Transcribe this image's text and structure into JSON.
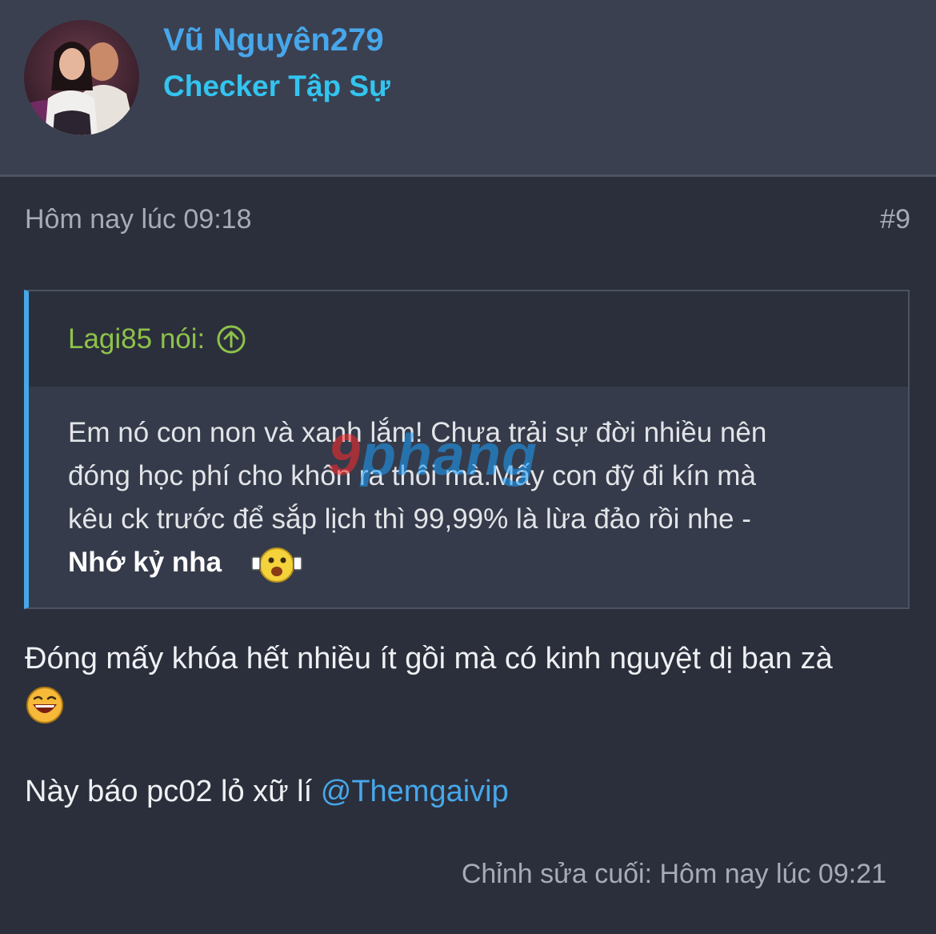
{
  "user": {
    "name": "Vũ Nguyên279",
    "title": "Checker Tập Sự",
    "avatar_icon": "profile-photo-avatar"
  },
  "post": {
    "time": "Hôm nay lúc 09:18",
    "number": "#9",
    "quote": {
      "author": "Lagi85 nói:",
      "jump_icon": "arrow-up-circle-icon",
      "lines": [
        "Em nó con non và xanh lắm! Chưa trải sự đời nhiều nên",
        "đóng học phí cho khôn ra thôi mà.Mấy con đỹ đi kín mà",
        "kêu ck trước để sắp lịch thì 99,99% là lừa đảo rồi nhe -"
      ],
      "bold_text": "Nhớ kỷ nha",
      "emoji_icon": "excited-emoji-icon"
    },
    "body": {
      "text": "Đóng mấy khóa hết nhiều ít gồi mà có kinh nguyệt dị bạn zà",
      "emoji_icon": "laughing-emoji-icon",
      "line2_text": "Này báo pc02 lỏ xữ lí ",
      "mention": "@Themgaivip"
    },
    "edited": "Chỉnh sửa cuối: Hôm nay lúc 09:21"
  },
  "watermark": {
    "first": "9",
    "rest": "phang"
  },
  "colors": {
    "background": "#2b2f3b",
    "header_background": "#3a4050",
    "username": "#47a7eb",
    "user_title": "#33c4ef",
    "quote_author": "#8ec24a",
    "muted_text": "#a6abb7",
    "link": "#47a7eb"
  }
}
